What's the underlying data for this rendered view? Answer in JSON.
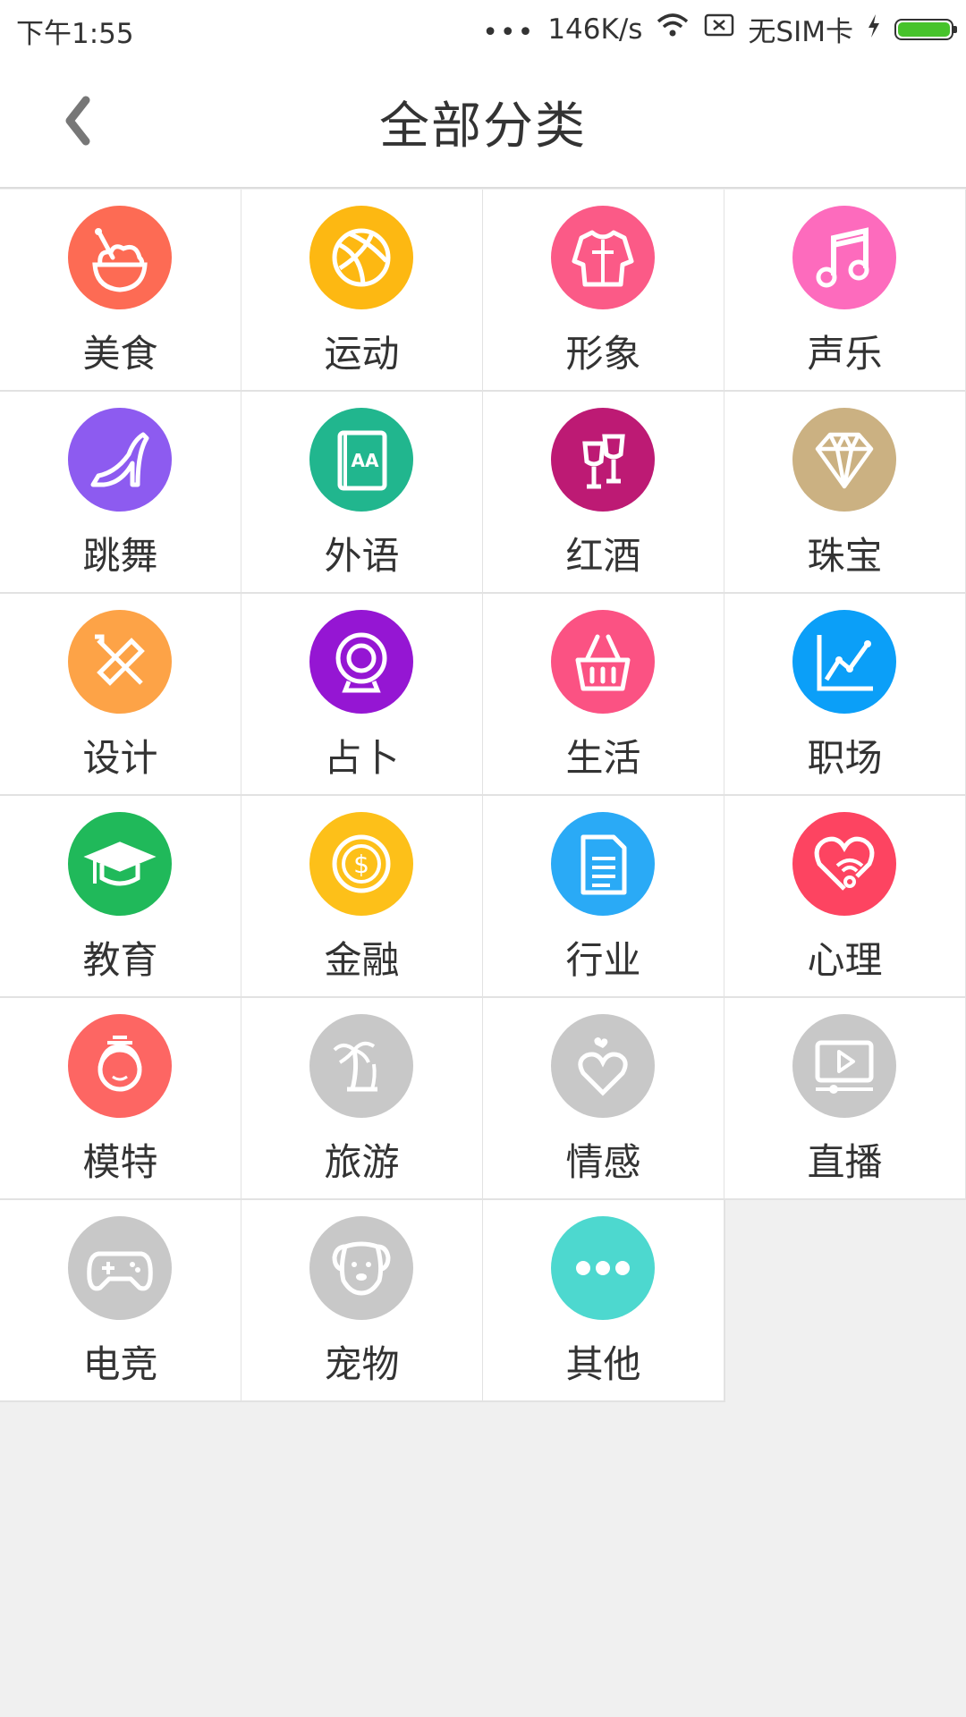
{
  "status_bar": {
    "time": "下午1:55",
    "dots": "•••",
    "speed": "146K/s",
    "sim": "无SIM卡",
    "icons": [
      "wifi-icon",
      "no-sim-icon",
      "charging-icon",
      "battery-icon"
    ]
  },
  "header": {
    "title": "全部分类",
    "back_icon": "chevron-left-icon"
  },
  "categories": [
    {
      "label": "美食",
      "color": "#fd6b54",
      "icon": "food-bowl-icon"
    },
    {
      "label": "运动",
      "color": "#fdb812",
      "icon": "ball-icon"
    },
    {
      "label": "形象",
      "color": "#fb5a87",
      "icon": "jacket-icon"
    },
    {
      "label": "声乐",
      "color": "#fd6bbd",
      "icon": "music-note-icon"
    },
    {
      "label": "跳舞",
      "color": "#8d5bf0",
      "icon": "high-heel-icon"
    },
    {
      "label": "外语",
      "color": "#21b68e",
      "icon": "book-aa-icon"
    },
    {
      "label": "红酒",
      "color": "#bd1a74",
      "icon": "wine-glass-icon"
    },
    {
      "label": "珠宝",
      "color": "#cbb182",
      "icon": "diamond-icon"
    },
    {
      "label": "设计",
      "color": "#fda347",
      "icon": "ruler-pencil-icon"
    },
    {
      "label": "占卜",
      "color": "#9516d3",
      "icon": "crystal-ball-icon"
    },
    {
      "label": "生活",
      "color": "#fb5283",
      "icon": "basket-icon"
    },
    {
      "label": "职场",
      "color": "#0b9ff8",
      "icon": "line-chart-icon"
    },
    {
      "label": "教育",
      "color": "#20b95a",
      "icon": "graduation-cap-icon"
    },
    {
      "label": "金融",
      "color": "#fdc019",
      "icon": "coin-icon"
    },
    {
      "label": "行业",
      "color": "#2aaaf6",
      "icon": "document-icon"
    },
    {
      "label": "心理",
      "color": "#fd4461",
      "icon": "heart-stethoscope-icon"
    },
    {
      "label": "模特",
      "color": "#fd6663",
      "icon": "girl-face-icon"
    },
    {
      "label": "旅游",
      "color": "#c8c8c8",
      "icon": "palm-tree-icon"
    },
    {
      "label": "情感",
      "color": "#c8c8c8",
      "icon": "hearts-icon"
    },
    {
      "label": "直播",
      "color": "#c8c8c8",
      "icon": "video-play-icon"
    },
    {
      "label": "电竞",
      "color": "#c8c8c8",
      "icon": "gamepad-icon"
    },
    {
      "label": "宠物",
      "color": "#c8c8c8",
      "icon": "dog-icon"
    },
    {
      "label": "其他",
      "color": "#4dd8cf",
      "icon": "more-dots-icon"
    }
  ]
}
